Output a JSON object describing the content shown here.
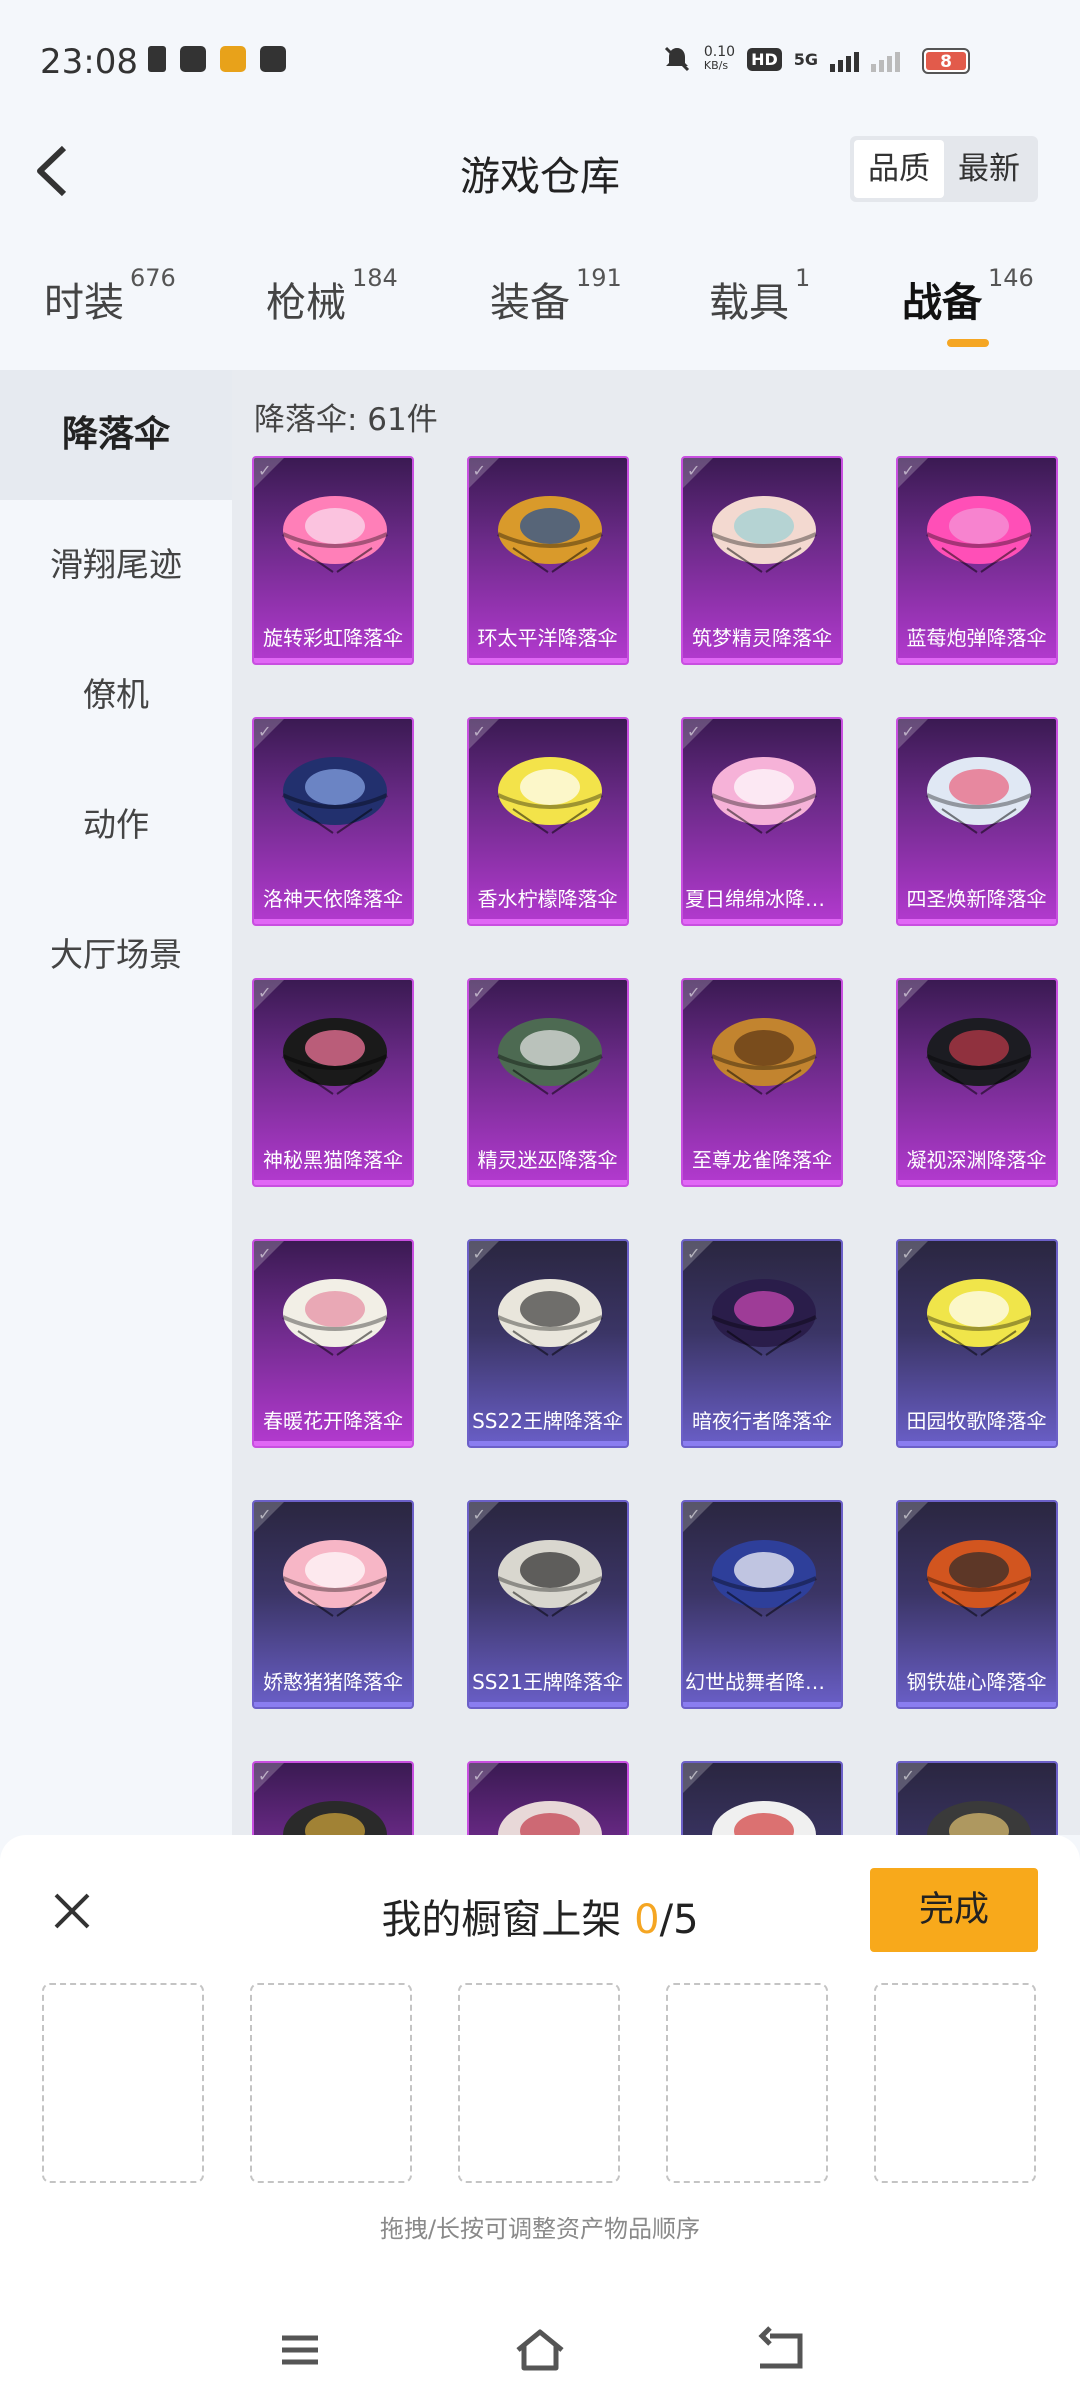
{
  "status_bar": {
    "time": "23:08",
    "net_speed_value": "0.10",
    "net_speed_unit": "KB/s",
    "hd_label": "HD",
    "network_label": "5G",
    "battery": "8"
  },
  "header": {
    "title": "游戏仓库",
    "sort_options": [
      "品质",
      "最新"
    ]
  },
  "tabs": [
    {
      "label": "时装",
      "count": "676"
    },
    {
      "label": "枪械",
      "count": "184"
    },
    {
      "label": "装备",
      "count": "191"
    },
    {
      "label": "载具",
      "count": "1"
    },
    {
      "label": "战备",
      "count": "146"
    }
  ],
  "sidebar": {
    "items": [
      "降落伞",
      "滑翔尾迹",
      "僚机",
      "动作",
      "大厅场景"
    ]
  },
  "content": {
    "count_label": "降落伞: 61件",
    "items": [
      {
        "name": "旋转彩虹降落伞",
        "rarity": "purple",
        "c1": "#ff7fb8",
        "c2": "#f9e0f0"
      },
      {
        "name": "环太平洋降落伞",
        "rarity": "purple",
        "c1": "#d99a2b",
        "c2": "#1f4f9a"
      },
      {
        "name": "筑梦精灵降落伞",
        "rarity": "purple",
        "c1": "#f3d9d0",
        "c2": "#9ad0d4"
      },
      {
        "name": "蓝莓炮弹降落伞",
        "rarity": "purple",
        "c1": "#ff4fb7",
        "c2": "#f39ad8"
      },
      {
        "name": "洛神天依降落伞",
        "rarity": "purple",
        "c1": "#22306e",
        "c2": "#8aa8e8"
      },
      {
        "name": "香水柠檬降落伞",
        "rarity": "purple",
        "c1": "#f3e34a",
        "c2": "#ffffff"
      },
      {
        "name": "夏日绵绵冰降落伞",
        "rarity": "purple",
        "c1": "#f6b2d8",
        "c2": "#ffffff"
      },
      {
        "name": "四圣焕新降落伞",
        "rarity": "purple",
        "c1": "#e0e8f4",
        "c2": "#e95f7a"
      },
      {
        "name": "神秘黑猫降落伞",
        "rarity": "purple",
        "c1": "#1a1a1a",
        "c2": "#ff7aa3"
      },
      {
        "name": "精灵迷巫降落伞",
        "rarity": "purple",
        "c1": "#4d6a52",
        "c2": "#e8e8e8"
      },
      {
        "name": "至尊龙雀降落伞",
        "rarity": "purple",
        "c1": "#c2842f",
        "c2": "#5a3414"
      },
      {
        "name": "凝视深渊降落伞",
        "rarity": "purple",
        "c1": "#1c1c22",
        "c2": "#c23a4a"
      },
      {
        "name": "春暖花开降落伞",
        "rarity": "purple",
        "c1": "#f2efe6",
        "c2": "#e58aa0"
      },
      {
        "name": "SS22王牌降落伞",
        "rarity": "blue",
        "c1": "#e9e6dc",
        "c2": "#3a3a3a"
      },
      {
        "name": "暗夜行者降落伞",
        "rarity": "blue",
        "c1": "#2a1d4a",
        "c2": "#d04ab8"
      },
      {
        "name": "田园牧歌降落伞",
        "rarity": "blue",
        "c1": "#f0e54a",
        "c2": "#ffffff"
      },
      {
        "name": "娇憨猪猪降落伞",
        "rarity": "blue",
        "c1": "#f7b6c6",
        "c2": "#ffffff"
      },
      {
        "name": "SS21王牌降落伞",
        "rarity": "blue",
        "c1": "#d9d7cf",
        "c2": "#2a2a2a"
      },
      {
        "name": "幻世战舞者降落伞",
        "rarity": "blue",
        "c1": "#2e3f9a",
        "c2": "#ffffff"
      },
      {
        "name": "钢铁雄心降落伞",
        "rarity": "blue",
        "c1": "#d2551f",
        "c2": "#2b2b2b"
      },
      {
        "name": "",
        "rarity": "purple",
        "c1": "#2a2a2a",
        "c2": "#d4a83a"
      },
      {
        "name": "",
        "rarity": "purple",
        "c1": "#e8d8d8",
        "c2": "#c23a4a"
      },
      {
        "name": "",
        "rarity": "blue",
        "c1": "#f0f0f0",
        "c2": "#d23a3a"
      },
      {
        "name": "",
        "rarity": "blue",
        "c1": "#3a3a3a",
        "c2": "#e0c070"
      }
    ]
  },
  "panel": {
    "title_prefix": "我的橱窗上架 ",
    "current": "0",
    "separator": "/",
    "max": "5",
    "done_label": "完成",
    "slot_count": 5,
    "hint": "拖拽/长按可调整资产物品顺序"
  },
  "colors": {
    "accent": "#f5a623",
    "rarity_purple": "#b43ad0",
    "rarity_blue": "#6a5fc8"
  },
  "icons": {
    "back": "back-arrow-icon",
    "close": "close-icon",
    "menu": "menu-icon",
    "home": "home-icon",
    "return": "return-icon"
  }
}
